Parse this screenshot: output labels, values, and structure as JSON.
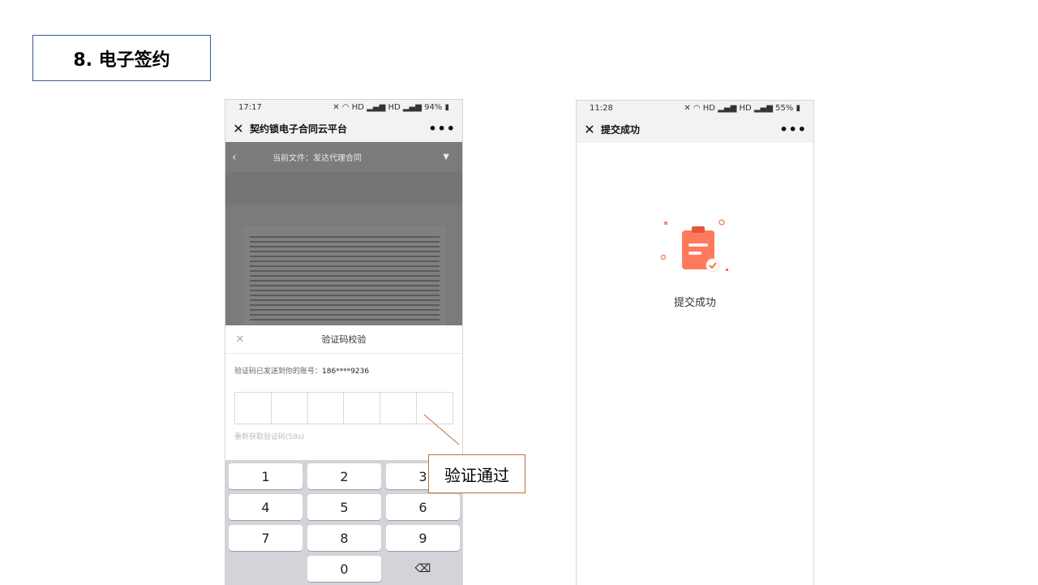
{
  "slide": {
    "title": "8. 电子签约",
    "callout": "验证通过"
  },
  "phone1": {
    "status": {
      "time": "17:17",
      "right": "✕ ◠ HD ▂▄▆ HD ▂▄▆ 94% ▮"
    },
    "nav": {
      "title": "契约锁电子合同云平台",
      "more": "•••"
    },
    "doc": {
      "label": "当前文件：发达代理合同"
    },
    "sheet": {
      "title": "验证码校验",
      "sent_prefix": "验证码已发送到你的账号：",
      "phone": "186****9236",
      "resend": "重新获取验证码(58s)"
    },
    "keypad": [
      "1",
      "2",
      "3",
      "4",
      "5",
      "6",
      "7",
      "8",
      "9",
      "",
      "0",
      "⌫"
    ]
  },
  "phone2": {
    "status": {
      "time": "11:28",
      "right": "✕ ◠ HD ▂▄▆ HD ▂▄▆ 55% ▮"
    },
    "nav": {
      "title": "提交成功",
      "more": "•••"
    },
    "message": "提交成功"
  },
  "colors": {
    "accent": "#ff6a4d",
    "overlay": "#7b7b7b",
    "callout_border": "#c0703a"
  }
}
